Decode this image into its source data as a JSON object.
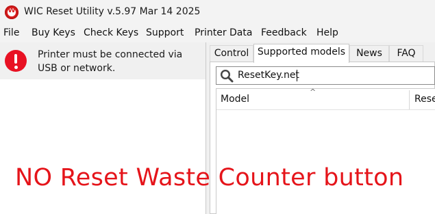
{
  "window": {
    "title": "WIC Reset Utility v.5.97 Mar 14 2025",
    "icon": "wic-logo-icon",
    "icon_letter": "W"
  },
  "menu": {
    "items": [
      "File",
      "Buy Keys",
      "Check Keys",
      "Support",
      "Printer Data",
      "Feedback",
      "Help"
    ]
  },
  "status": {
    "icon": "error-icon",
    "message": "Printer must be connected via USB or network."
  },
  "tabs": {
    "items": [
      "Control",
      "Supported models",
      "News",
      "FAQ"
    ],
    "active": "Supported models"
  },
  "search": {
    "icon": "search-icon",
    "value": "ResetKey.net"
  },
  "table": {
    "columns": [
      "Model",
      "Rese"
    ],
    "sort_indicator": "^",
    "rows": []
  },
  "annotation": {
    "text": "NO Reset Waste Counter button",
    "color": "#e5141a"
  },
  "colors": {
    "error_red": "#e81123",
    "brand_red": "#d81f1f",
    "chrome_bg": "#f3f3f3"
  }
}
